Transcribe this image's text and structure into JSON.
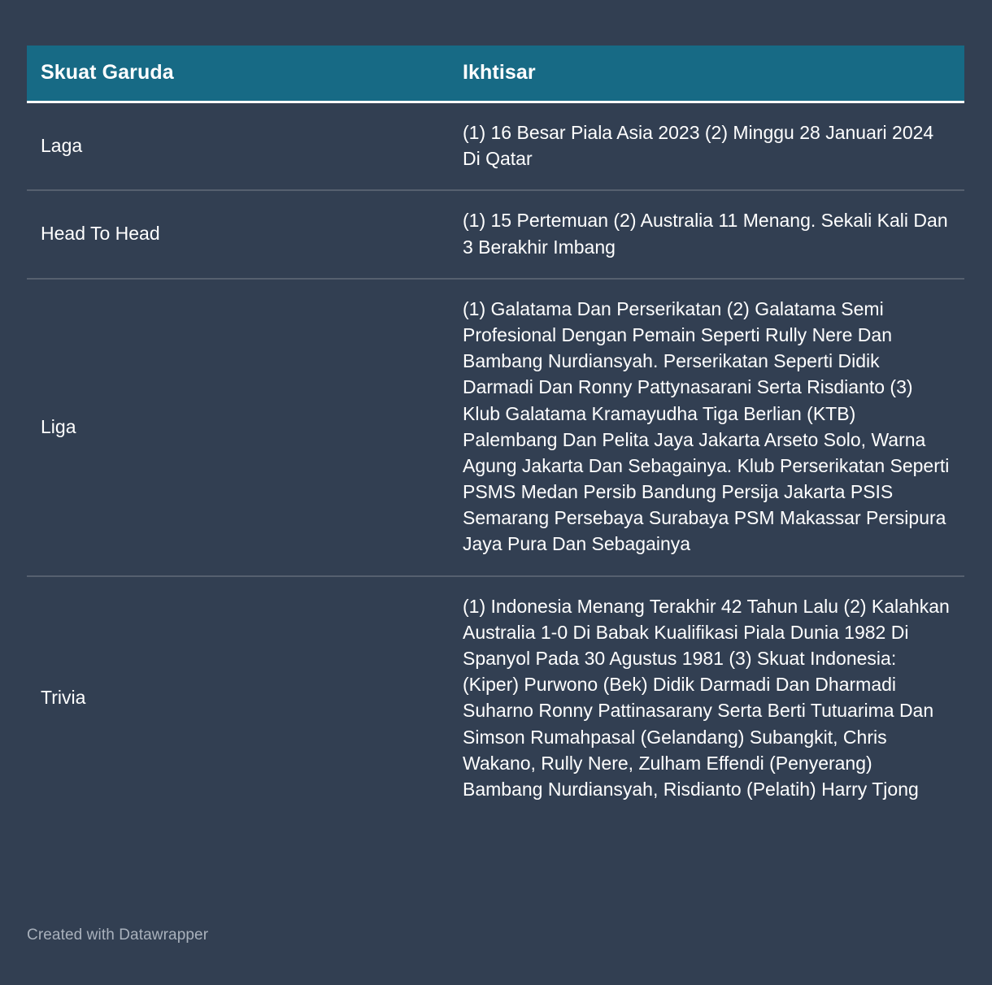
{
  "theme": {
    "background_color": "#323f52",
    "header_background_color": "#176a85",
    "header_text_color": "#ffffff",
    "body_text_color": "#ffffff",
    "row_divider_color": "#56606f",
    "header_underline_color": "#ffffff",
    "footer_text_color": "#a9b1bc"
  },
  "table": {
    "columns": [
      {
        "key": "label",
        "header": "Skuat Garuda"
      },
      {
        "key": "value",
        "header": "Ikhtisar"
      }
    ],
    "rows": [
      {
        "label": "Laga",
        "value": "(1) 16 Besar Piala Asia 2023 (2) Minggu 28 Januari 2024 Di Qatar"
      },
      {
        "label": "Head To Head",
        "value": "(1) 15 Pertemuan (2) Australia 11 Menang. Sekali Kali Dan 3 Berakhir Imbang"
      },
      {
        "label": "Liga",
        "value": "(1) Galatama Dan Perserikatan (2) Galatama Semi Profesional Dengan Pemain Seperti Rully Nere Dan Bambang Nurdiansyah. Perserikatan Seperti Didik Darmadi Dan Ronny Pattynasarani Serta Risdianto (3) Klub Galatama Kramayudha Tiga Berlian (KTB) Palembang Dan Pelita Jaya Jakarta Arseto Solo, Warna Agung Jakarta Dan Sebagainya. Klub Perserikatan Seperti PSMS Medan Persib Bandung Persija Jakarta PSIS Semarang Persebaya Surabaya PSM Makassar Persipura Jaya Pura Dan Sebagainya"
      },
      {
        "label": "Trivia",
        "value": "(1) Indonesia Menang Terakhir 42 Tahun Lalu (2) Kalahkan Australia 1-0 Di Babak Kualifikasi Piala Dunia 1982 Di Spanyol Pada 30 Agustus 1981 (3) Skuat Indonesia: (Kiper) Purwono (Bek) Didik Darmadi Dan Dharmadi Suharno Ronny Pattinasarany Serta Berti Tutuarima Dan Simson Rumahpasal (Gelandang) Subangkit, Chris Wakano, Rully Nere, Zulham Effendi (Penyerang) Bambang Nurdiansyah, Risdianto (Pelatih) Harry Tjong"
      }
    ]
  },
  "footer": {
    "credit": "Created with Datawrapper"
  }
}
